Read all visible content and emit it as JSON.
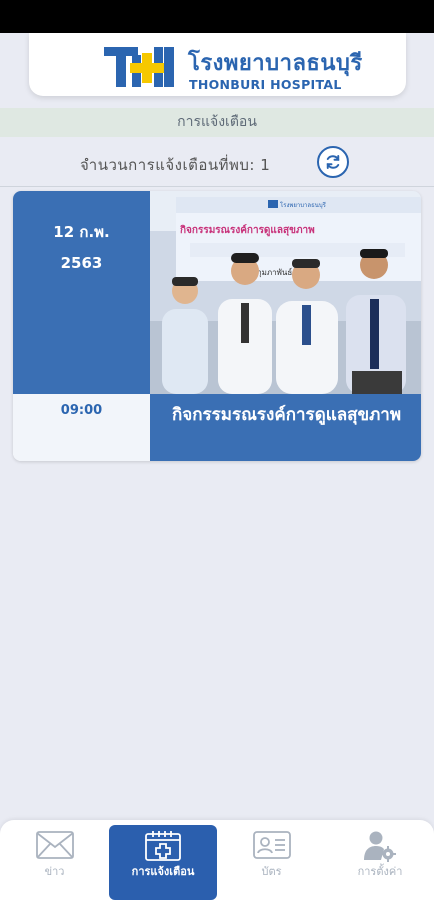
{
  "header": {
    "logo_thai": "โรงพยาบาลธนบุรี",
    "logo_english": "THONBURI HOSPITAL",
    "brand_colors": {
      "blue": "#2b65b0",
      "yellow": "#f6c800"
    }
  },
  "section": {
    "title": "การแจ้งเตือน"
  },
  "notifications": {
    "count_label": "จำนวนการแจ้งเตือนที่พบ:",
    "count_value": "1",
    "refresh_icon": "refresh-icon"
  },
  "card": {
    "date_line1": "12 ก.พ.",
    "date_line2": "2563",
    "time": "09:00",
    "title": "กิจกรรมรณรงค์การดูแลสุขภาพ",
    "photo_banner_line1": "กิจกรรมรณรงค์การดูแลสุขภาพ",
    "photo_banner_date": "12 กุมภาพันธ์ 2563",
    "accent_color": "#3a6fb4"
  },
  "tabs": [
    {
      "label": "ข่าว",
      "icon": "mail-icon",
      "active": false
    },
    {
      "label": "การแจ้งเตือน",
      "icon": "calendar-plus-icon",
      "active": true
    },
    {
      "label": "บัตร",
      "icon": "id-card-icon",
      "active": false
    },
    {
      "label": "การตั้งค่า",
      "icon": "user-settings-icon",
      "active": false
    }
  ]
}
